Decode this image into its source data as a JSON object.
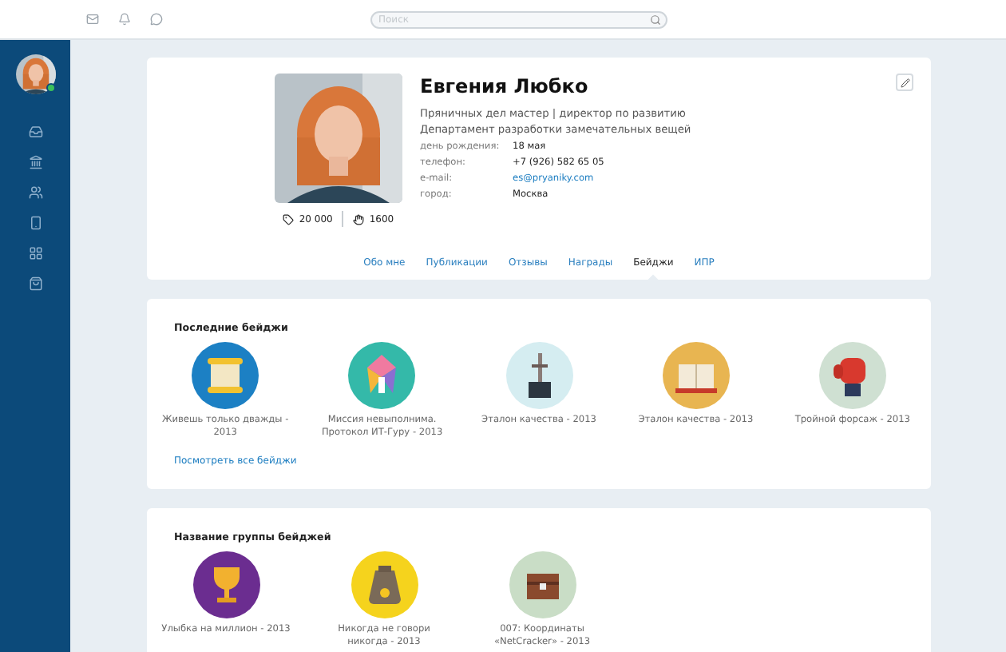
{
  "topbar": {
    "search": {
      "placeholder": "Поиск"
    }
  },
  "sidebar": {
    "user_online": true
  },
  "profile": {
    "name": "Евгения Любко",
    "position": "Пряничных дел мастер | директор по развитию",
    "department": "Департамент разработки замечательных вещей",
    "fields": [
      {
        "label": "день рождения:",
        "value": "18 мая",
        "kind": "text"
      },
      {
        "label": "телефон:",
        "value": "+7 (926) 582 65 05",
        "kind": "text"
      },
      {
        "label": "e-mail:",
        "value": "es@pryaniky.com",
        "kind": "link"
      },
      {
        "label": "город:",
        "value": "Москва",
        "kind": "text"
      }
    ],
    "stats": [
      {
        "kind": "tag",
        "value": "20 000"
      },
      {
        "kind": "thanks",
        "value": "1600"
      }
    ],
    "tabs": [
      {
        "label": "Обо мне",
        "selected": false
      },
      {
        "label": "Публикации",
        "selected": false
      },
      {
        "label": "Отзывы",
        "selected": false
      },
      {
        "label": "Награды",
        "selected": false
      },
      {
        "label": "Бейджи",
        "selected": true
      },
      {
        "label": "ИПР",
        "selected": false
      }
    ]
  },
  "sections": [
    {
      "title": "Последние бейджи",
      "link": "Посмотреть все бейджи",
      "badges": [
        {
          "label": "Живешь только дважды - 2013",
          "kind": "scroll",
          "color": "#1c80c4"
        },
        {
          "label": "Миссия невыполнима. Протокол ИТ-Гуру - 2013",
          "kind": "puzzle",
          "color": "#34b9a9"
        },
        {
          "label": "Эталон качества - 2013",
          "kind": "sword",
          "color": "#d5edf1"
        },
        {
          "label": "Эталон качества - 2013",
          "kind": "book",
          "color": "#e8b551"
        },
        {
          "label": "Тройной форсаж - 2013",
          "kind": "glove",
          "color": "#cfe0d2"
        }
      ]
    },
    {
      "title": "Название группы бейджей",
      "badges": [
        {
          "label": "Улыбка на миллион - 2013",
          "kind": "trophy",
          "color": "#6b2d90"
        },
        {
          "label": "Никогда не говори никогда - 2013",
          "kind": "bag",
          "color": "#f5d31d"
        },
        {
          "label": "007: Координаты «NetCracker» - 2013",
          "kind": "chest",
          "color": "#c9ddc6"
        }
      ]
    }
  ]
}
